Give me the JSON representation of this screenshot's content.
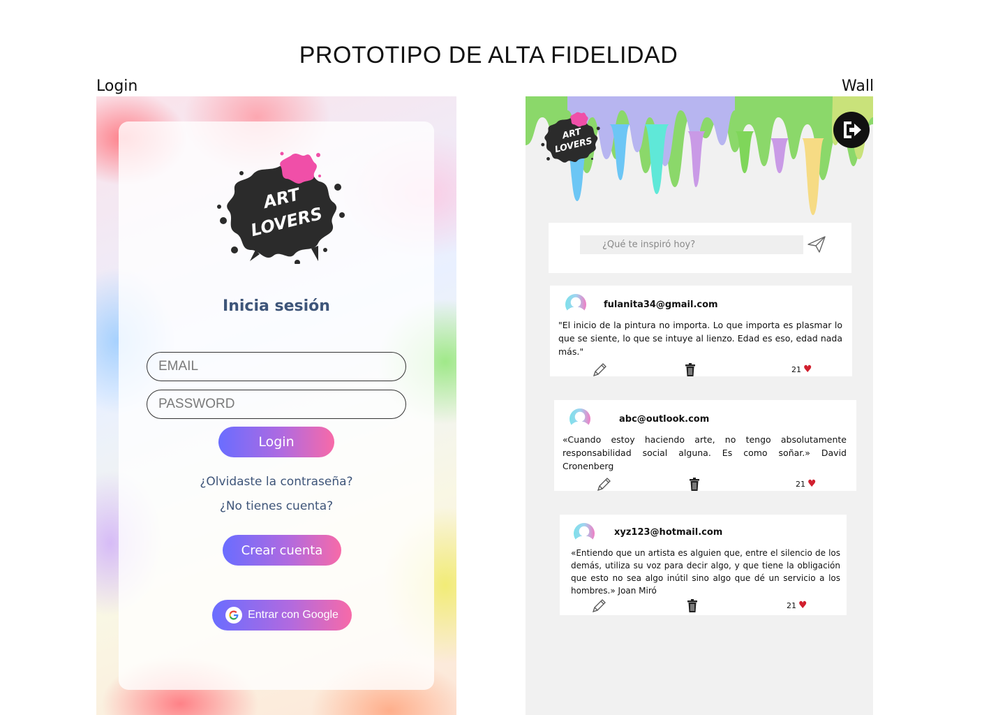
{
  "page": {
    "title": "PROTOTIPO DE ALTA FIDELIDAD",
    "login_label": "Login",
    "wall_label": "Wall"
  },
  "login": {
    "logo_text": [
      "ART",
      "LOVERS"
    ],
    "heading": "Inicia sesión",
    "email_placeholder": "EMAIL",
    "password_placeholder": "PASSWORD",
    "login_button": "Login",
    "forgot_password_link": "¿Olvidaste la contraseña?",
    "no_account_link": "¿No tienes cuenta?",
    "create_account_button": "Crear cuenta",
    "google_button": "Entrar con Google"
  },
  "wall": {
    "logo_text": [
      "ART",
      "LOVERS"
    ],
    "composer_placeholder": "¿Qué te inspiró hoy?",
    "posts": [
      {
        "email": "fulanita34@gmail.com",
        "text": "\"El inicio de la pintura no importa. Lo que importa es plasmar lo que se siente, lo que se intuye al lienzo. Edad es eso, edad nada más.\"",
        "likes": "21"
      },
      {
        "email": "abc@outlook.com",
        "text": "«Cuando estoy haciendo arte, no tengo absolutamente responsabilidad social alguna. Es como soñar.» David Cronenberg",
        "likes": "21"
      },
      {
        "email": "xyz123@hotmail.com",
        "text": "«Entiendo que un artista es alguien que, entre el silencio de los demás, utiliza su voz para decir algo, y que tiene la obligación que esto no sea algo inútil sino algo que dé un servicio a los hombres.» Joan Miró",
        "likes": "21"
      }
    ]
  },
  "colors": {
    "heading_blue": "#3e5579",
    "gradient_start": "#6a6dff",
    "gradient_end": "#f76aa8",
    "logo_splat": "#2b2b2b",
    "logo_pink": "#f04fa8",
    "heart_red": "#d11f2e",
    "wall_background": "#f1f1f1"
  },
  "icons": {
    "logout": "logout-arrow-icon",
    "send": "paper-plane-icon",
    "edit": "pencil-icon",
    "delete": "trash-icon",
    "like": "heart-icon",
    "google": "google-g-icon"
  }
}
